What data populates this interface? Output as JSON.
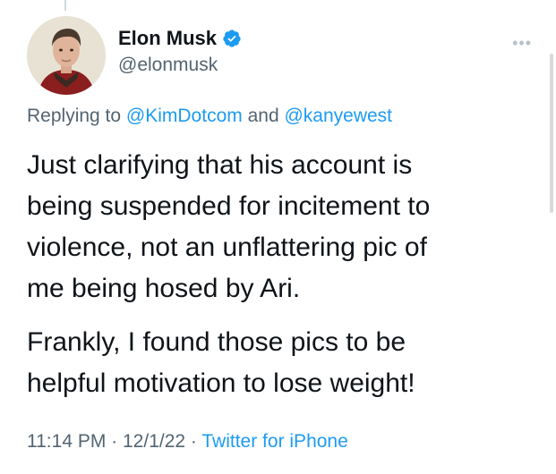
{
  "user": {
    "display_name": "Elon Musk",
    "handle": "@elonmusk"
  },
  "reply": {
    "prefix": "Replying to ",
    "mention_1": "@KimDotcom",
    "conjunction": " and ",
    "mention_2": "@kanyewest"
  },
  "tweet": {
    "lines": [
      "Just clarifying that his account is",
      "being suspended for incitement to",
      "violence, not an unflattering pic of",
      "me being hosed by Ari.",
      "Frankly, I found those pics to be",
      "helpful motivation to lose weight!"
    ]
  },
  "meta": {
    "time": "11:14 PM",
    "separator": " · ",
    "date": "12/1/22",
    "source": "Twitter for iPhone"
  },
  "icons": {
    "more": "more-horizontal-icon",
    "verified": "verified-badge-icon"
  },
  "colors": {
    "link": "#1d9bf0",
    "secondary": "#536471",
    "text": "#0f1419"
  }
}
